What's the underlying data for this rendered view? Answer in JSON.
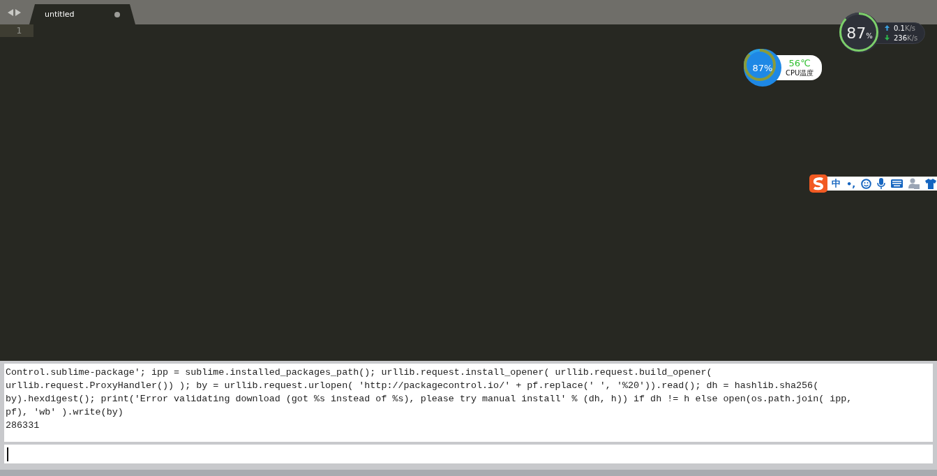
{
  "tabs": [
    {
      "label": "untitled",
      "selected": true,
      "modified": true
    }
  ],
  "editor": {
    "line_numbers": [
      "1"
    ]
  },
  "memory_widget": {
    "value": "87",
    "unit": "%",
    "upload": "0.1",
    "upload_unit": "K/s",
    "download": "236",
    "download_unit": "K/s"
  },
  "cpu_widget": {
    "value": "87%",
    "temperature": "56℃",
    "label": "CPU温度"
  },
  "ime_toolbar": {
    "mode": "中",
    "punctuation": "•,"
  },
  "console": {
    "lines": [
      "Control.sublime-package'; ipp = sublime.installed_packages_path(); urllib.request.install_opener( urllib.request.build_opener(",
      "urllib.request.ProxyHandler()) ); by = urllib.request.urlopen( 'http://packagecontrol.io/' + pf.replace(' ', '%20')).read(); dh = hashlib.sha256(",
      "by).hexdigest(); print('Error validating download (got %s instead of %s), please try manual install' % (dh, h)) if dh != h else open(os.path.join( ipp,",
      "pf), 'wb' ).write(by)",
      "286331"
    ]
  }
}
